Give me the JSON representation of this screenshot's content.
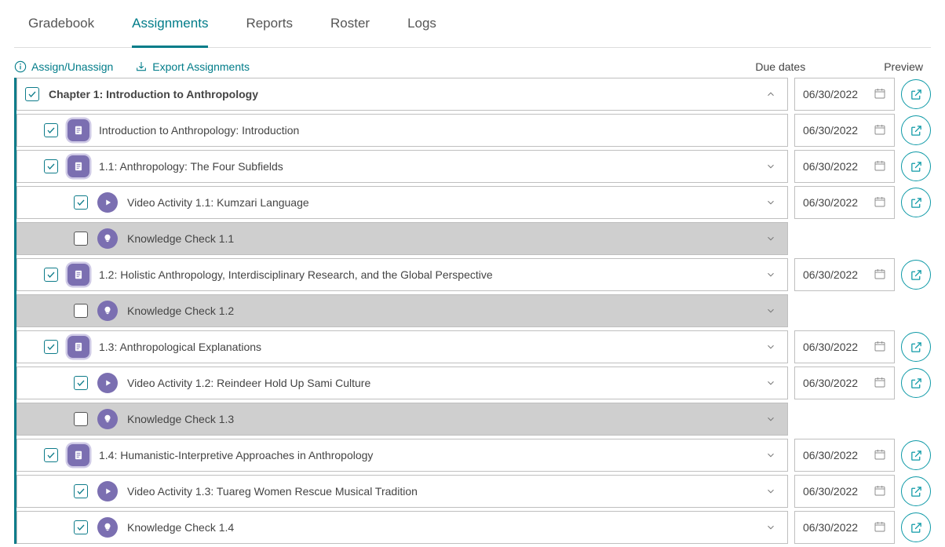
{
  "tabs": [
    "Gradebook",
    "Assignments",
    "Reports",
    "Roster",
    "Logs"
  ],
  "active_tab": 1,
  "toolbar": {
    "assign_label": "Assign/Unassign",
    "export_label": "Export Assignments"
  },
  "columns": {
    "due": "Due dates",
    "preview": "Preview"
  },
  "items": [
    {
      "level": 0,
      "type": "chapter",
      "checked": true,
      "title": "Chapter 1: Introduction to Anthropology",
      "expand": "up",
      "due": "06/30/2022",
      "preview": true
    },
    {
      "level": 1,
      "type": "doc",
      "checked": true,
      "title": "Introduction to Anthropology: Introduction",
      "expand": null,
      "due": "06/30/2022",
      "preview": true
    },
    {
      "level": 1,
      "type": "doc",
      "checked": true,
      "title": "1.1: Anthropology: The Four Subfields",
      "expand": "down",
      "due": "06/30/2022",
      "preview": true
    },
    {
      "level": 2,
      "type": "video",
      "checked": true,
      "title": "Video Activity 1.1: Kumzari Language",
      "expand": "down",
      "due": "06/30/2022",
      "preview": true
    },
    {
      "level": 2,
      "type": "bulb",
      "checked": false,
      "title": "Knowledge Check 1.1",
      "expand": "down",
      "due": null,
      "preview": false,
      "kc": true
    },
    {
      "level": 1,
      "type": "doc",
      "checked": true,
      "title": "1.2: Holistic Anthropology, Interdisciplinary Research, and the Global Perspective",
      "expand": "down",
      "due": "06/30/2022",
      "preview": true
    },
    {
      "level": 2,
      "type": "bulb",
      "checked": false,
      "title": "Knowledge Check 1.2",
      "expand": "down",
      "due": null,
      "preview": false,
      "kc": true
    },
    {
      "level": 1,
      "type": "doc",
      "checked": true,
      "title": "1.3: Anthropological Explanations",
      "expand": "down",
      "due": "06/30/2022",
      "preview": true
    },
    {
      "level": 2,
      "type": "video",
      "checked": true,
      "title": "Video Activity 1.2: Reindeer Hold Up Sami Culture",
      "expand": "down",
      "due": "06/30/2022",
      "preview": true
    },
    {
      "level": 2,
      "type": "bulb",
      "checked": false,
      "title": "Knowledge Check 1.3",
      "expand": "down",
      "due": null,
      "preview": false,
      "kc": true
    },
    {
      "level": 1,
      "type": "doc",
      "checked": true,
      "title": "1.4: Humanistic-Interpretive Approaches in Anthropology",
      "expand": "down",
      "due": "06/30/2022",
      "preview": true
    },
    {
      "level": 2,
      "type": "video",
      "checked": true,
      "title": "Video Activity 1.3: Tuareg Women Rescue Musical Tradition",
      "expand": "down",
      "due": "06/30/2022",
      "preview": true
    },
    {
      "level": 2,
      "type": "bulb",
      "checked": true,
      "title": "Knowledge Check 1.4",
      "expand": "down",
      "due": "06/30/2022",
      "preview": true
    }
  ]
}
